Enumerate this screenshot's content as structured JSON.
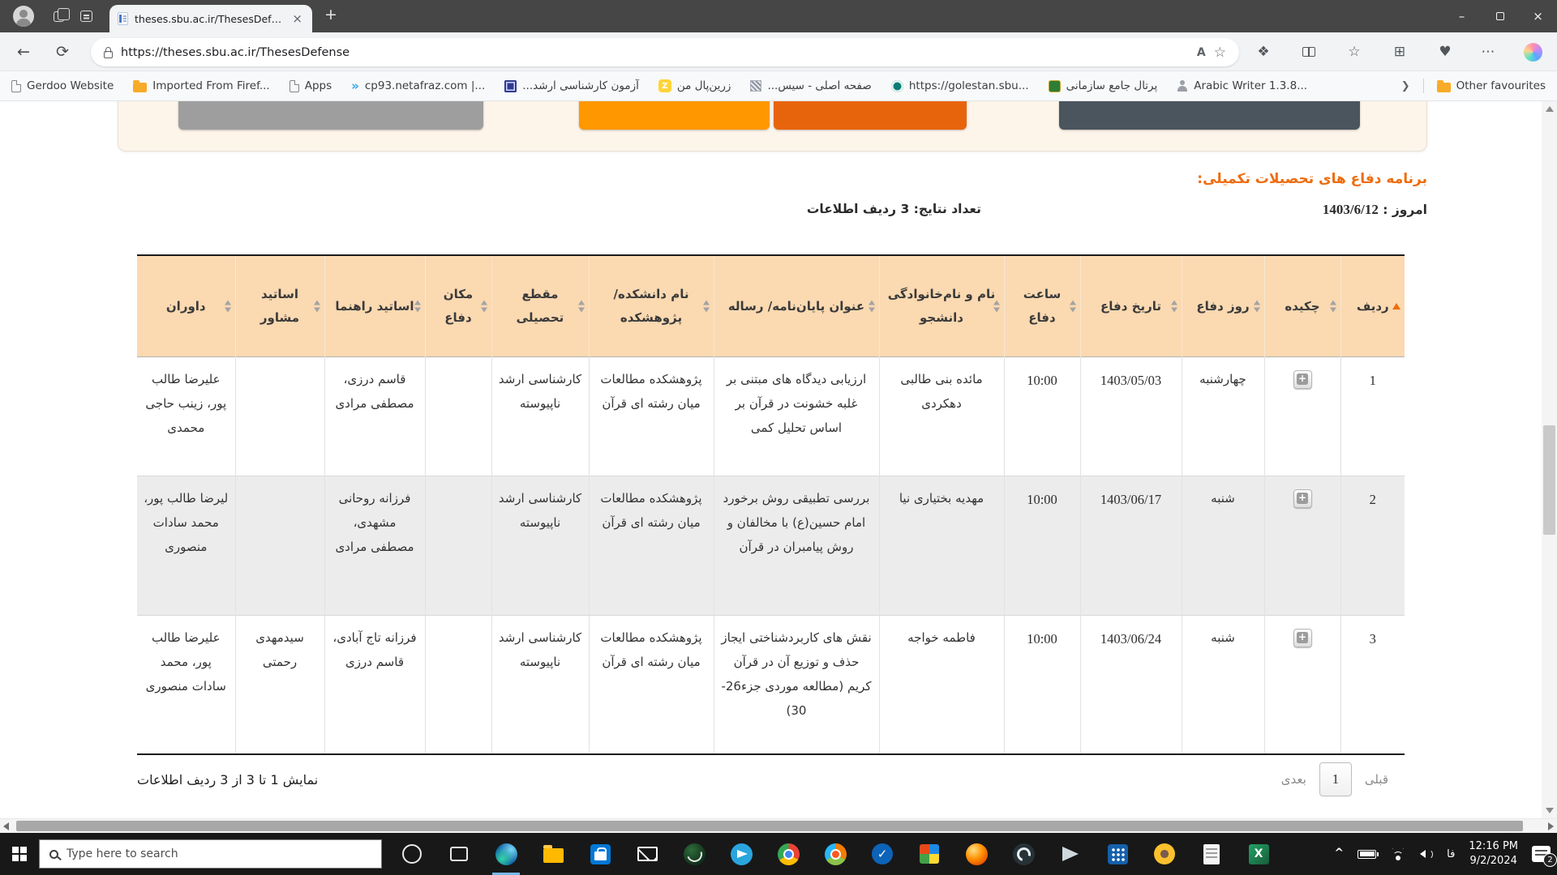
{
  "browser": {
    "tab": {
      "title": "theses.sbu.ac.ir/ThesesDefense"
    },
    "new_tab_glyph": "+",
    "url": "https://theses.sbu.ac.ir/ThesesDefense",
    "bookmarks": [
      {
        "label": "Gerdoo Website",
        "icon": "page-icon"
      },
      {
        "label": "Imported From Firef...",
        "icon": "folder-icon"
      },
      {
        "label": "Apps",
        "icon": "page-icon"
      },
      {
        "label": "cp93.netafraz.com |...",
        "icon": "chevrons-icon"
      },
      {
        "label": "آزمون کارشناسی ارشد...",
        "icon": "emblem-icon"
      },
      {
        "label": "زرین‌پال من",
        "icon": "zarinpal-icon"
      },
      {
        "label": "صفحه اصلی - سیس...",
        "icon": "qr-icon"
      },
      {
        "label": "https://golestan.sbu...",
        "icon": "golestan-icon"
      },
      {
        "label": "پرتال جامع سازمانی",
        "icon": "portal-icon"
      },
      {
        "label": "Arabic Writer 1.3.8...",
        "icon": "writer-icon"
      }
    ],
    "other_favourites": "Other favourites"
  },
  "icons": {
    "back": "←",
    "refresh": "⟳",
    "read_aloud": "A",
    "favorite_star": "☆",
    "extensions": "❖",
    "favourites_bar": "☆",
    "collections": "⊞",
    "essentials": "♥",
    "settings_dots": "⋯",
    "minimize": "–",
    "close": "×",
    "tab_close": "×",
    "bookmarks_chevron": "❯",
    "zarinpal_letter": "Z"
  },
  "page": {
    "heading": "برنامه دفاع های تحصیلات تکمیلی:",
    "today": {
      "label": "امروز :",
      "value": "1403/6/12"
    },
    "results": "تعداد نتایج: 3 ردیف اطلاعات",
    "table": {
      "columns": [
        {
          "label": "ردیف",
          "sort": "asc"
        },
        {
          "label": "چکیده",
          "sort": "both"
        },
        {
          "label": "روز دفاع",
          "sort": "both"
        },
        {
          "label": "تاریخ دفاع",
          "sort": "both"
        },
        {
          "label": "ساعت دفاع",
          "sort": "both"
        },
        {
          "label": "نام و نام‌خانوادگی دانشجو",
          "sort": "both"
        },
        {
          "label": "عنوان پایان‌نامه/ رساله",
          "sort": "both"
        },
        {
          "label": "نام دانشکده/ پژوهشکده",
          "sort": "both"
        },
        {
          "label": "مقطع تحصیلی",
          "sort": "both"
        },
        {
          "label": "مکان دفاع",
          "sort": "both"
        },
        {
          "label": "اساتید راهنما",
          "sort": "both"
        },
        {
          "label": "اساتید مشاور",
          "sort": "both"
        },
        {
          "label": "داوران",
          "sort": "both"
        }
      ],
      "rows": [
        {
          "radif": "1",
          "day": "چهارشنبه",
          "date": "1403/05/03",
          "time": "10:00",
          "student": "مائده بنی طالبی دهکردی",
          "title": "ارزیابی دیدگاه های مبتنی بر غلبه خشونت در قرآن بر اساس تحلیل کمی",
          "faculty": "پژوهشکده مطالعات میان رشته ای قرآن",
          "level": "کارشناسی ارشد ناپیوسته",
          "location": "",
          "supervisors": "قاسم درزی، مصطفی مرادی",
          "advisors": "",
          "judges": "علیرضا طالب پور، زینب حاجی محمدی"
        },
        {
          "radif": "2",
          "day": "شنبه",
          "date": "1403/06/17",
          "time": "10:00",
          "student": "مهدیه بختیاری نیا",
          "title": "بررسی تطبیقی روش برخورد امام حسین(ع) با مخالفان و روش پیامبران در قرآن",
          "faculty": "پژوهشکده مطالعات میان رشته ای قرآن",
          "level": "کارشناسی ارشد ناپیوسته",
          "location": "",
          "supervisors": "فرزانه روحانی مشهدی، مصطفی مرادی",
          "advisors": "",
          "judges": "لیرضا طالب پور، محمد سادات منصوری"
        },
        {
          "radif": "3",
          "day": "شنبه",
          "date": "1403/06/24",
          "time": "10:00",
          "student": "فاطمه خواجه",
          "title": "نقش های کاربردشناختی ایجاز حذف و توزیع آن در قرآن کریم (مطالعه موردی جزء26-30)",
          "faculty": "پژوهشکده مطالعات میان رشته ای قرآن",
          "level": "کارشناسی ارشد ناپیوسته",
          "location": "",
          "supervisors": "فرزانه تاج آبادی، قاسم درزی",
          "advisors": "سیدمهدی رحمتی",
          "judges": "علیرضا طالب پور، محمد سادات منصوری"
        }
      ]
    },
    "abstract_button_glyph": "+",
    "showing": "نمایش 1 تا 3 از 3 ردیف اطلاعات",
    "pagination": {
      "prev": "قبلی",
      "page": "1",
      "next": "بعدی"
    }
  },
  "colors": {
    "accent_orange": "#ee6c0d",
    "table_header_bg": "#fbd9b1",
    "stripe_row": "#ececec",
    "button_gray": "#9e9e9e",
    "button_orange": "#ff9800",
    "button_dark_orange": "#e8640c",
    "button_slate": "#4a555e"
  },
  "taskbar": {
    "search_placeholder": "Type here to search",
    "language": "فا",
    "time": "12:16 PM",
    "date": "9/2/2024",
    "notification_badge": "2"
  }
}
